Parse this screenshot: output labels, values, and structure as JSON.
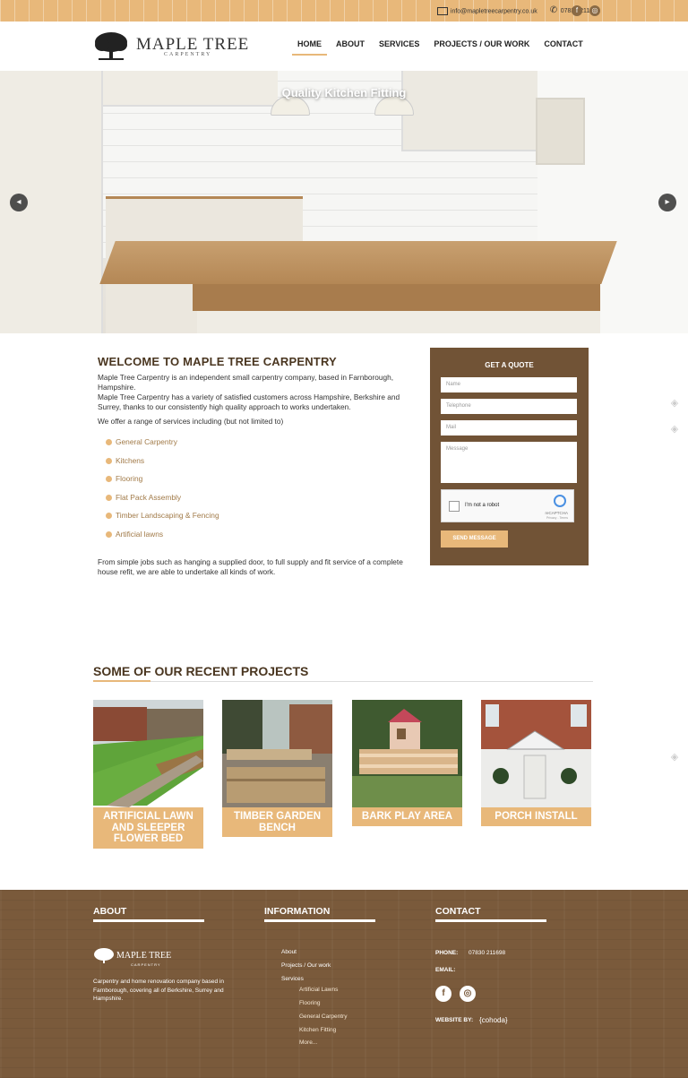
{
  "topbar": {
    "email": "info@mapletreecarpentry.co.uk",
    "phone": "07830 211698",
    "social": [
      {
        "icon": "facebook-icon",
        "label": "f"
      },
      {
        "icon": "instagram-icon",
        "label": "◎"
      }
    ]
  },
  "brand": {
    "name": "MAPLE TREE",
    "sub": "CARPENTRY"
  },
  "nav": {
    "items": [
      "HOME",
      "ABOUT",
      "SERVICES",
      "PROJECTS / OUR WORK",
      "CONTACT"
    ],
    "active": "HOME"
  },
  "hero": {
    "title": "Quality Kitchen Fitting",
    "prev": "◂",
    "next": "▸"
  },
  "welcome": {
    "heading": "WELCOME TO MAPLE TREE CARPENTRY",
    "p1": "Maple Tree Carpentry is an independent small carpentry company, based in Farnborough, Hampshire.",
    "p2": "Maple Tree Carpentry has a variety of satisfied customers across Hampshire, Berkshire and Surrey, thanks to our consistently high quality approach to works undertaken.",
    "p3": "We offer a range of services including (but not limited to)",
    "services": [
      "General Carpentry",
      "Kitchens",
      "Flooring",
      "Flat Pack Assembly",
      "Timber Landscaping & Fencing",
      "Artificial lawns"
    ],
    "p4": "From simple jobs such as hanging a supplied door, to full supply and fit service of a complete house refit, we are able to undertake all kinds of work."
  },
  "quote": {
    "title": "GET A QUOTE",
    "name_placeholder": "Name",
    "telephone_placeholder": "Telephone",
    "mail_placeholder": "Mail",
    "message_placeholder": "Message",
    "captcha_label": "I'm not a robot",
    "captcha_brand": "reCAPTCHA",
    "captcha_terms": "Privacy - Terms",
    "send_label": "SEND MESSAGE"
  },
  "projects": {
    "heading": "SOME OF OUR RECENT PROJECTS",
    "items": [
      {
        "caption": "ARTIFICIAL LAWN AND SLEEPER FLOWER BED"
      },
      {
        "caption": "TIMBER GARDEN BENCH"
      },
      {
        "caption": "BARK PLAY AREA"
      },
      {
        "caption": "PORCH INSTALL"
      }
    ]
  },
  "footer": {
    "about_title": "ABOUT",
    "about_brand": "MAPLE TREE",
    "about_brand_sub": "CARPENTRY",
    "about_text": "Carpentry and home renovation company based in Farnborough, covering all of Berkshire, Surrey and Hampshire.",
    "info_title": "INFORMATION",
    "links": [
      "About",
      "Projects / Our work",
      "Services"
    ],
    "sublinks": [
      "Artificial Lawns",
      "Flooring",
      "General Carpentry",
      "Kitchen Fitting",
      "More..."
    ],
    "contact_title": "CONTACT",
    "phone_label": "PHONE:",
    "phone": "07830 211698",
    "email_label": "EMAIL:",
    "social": [
      "f",
      "◎"
    ],
    "credit_label": "WEBSITE BY:",
    "credit": "{cohoda}"
  },
  "colors": {
    "accent": "#e8b87a",
    "brown": "#715336",
    "footer": "#7a5a3b",
    "heading": "#4a3620"
  }
}
